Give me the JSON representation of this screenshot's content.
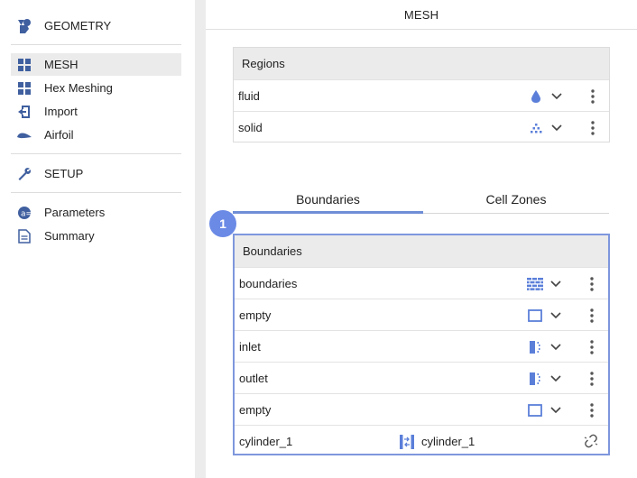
{
  "sidebar": {
    "items": [
      {
        "label": "GEOMETRY",
        "icon": "shapes-icon"
      },
      {
        "label": "MESH",
        "icon": "grid-icon"
      },
      {
        "label": "Hex Meshing",
        "icon": "grid-icon"
      },
      {
        "label": "Import",
        "icon": "import-icon"
      },
      {
        "label": "Airfoil",
        "icon": "airfoil-icon"
      },
      {
        "label": "SETUP",
        "icon": "wrench-icon"
      },
      {
        "label": "Parameters",
        "icon": "parameters-icon"
      },
      {
        "label": "Summary",
        "icon": "document-icon"
      }
    ],
    "active_index": 1
  },
  "main": {
    "title": "MESH",
    "regions": {
      "title": "Regions",
      "rows": [
        {
          "name": "fluid",
          "icon": "droplet-icon"
        },
        {
          "name": "solid",
          "icon": "dots-pyramid-icon"
        }
      ]
    },
    "tabs": [
      {
        "label": "Boundaries",
        "active": true
      },
      {
        "label": "Cell Zones",
        "active": false
      }
    ],
    "badge": "1",
    "boundaries": {
      "title": "Boundaries",
      "rows": [
        {
          "name": "boundaries",
          "icon": "brick-wall-icon"
        },
        {
          "name": "empty",
          "icon": "empty-square-icon"
        },
        {
          "name": "inlet",
          "icon": "inlet-icon"
        },
        {
          "name": "outlet",
          "icon": "outlet-icon"
        },
        {
          "name": "empty",
          "icon": "empty-square-icon"
        }
      ],
      "link_row": {
        "left": "cylinder_1",
        "right": "cylinder_1",
        "icon": "interface-icon"
      }
    }
  },
  "colors": {
    "accent": "#5b7fd9",
    "badge": "#6b8ae6",
    "icon": "#3f5f9f",
    "highlight_border": "#7e97dd"
  }
}
